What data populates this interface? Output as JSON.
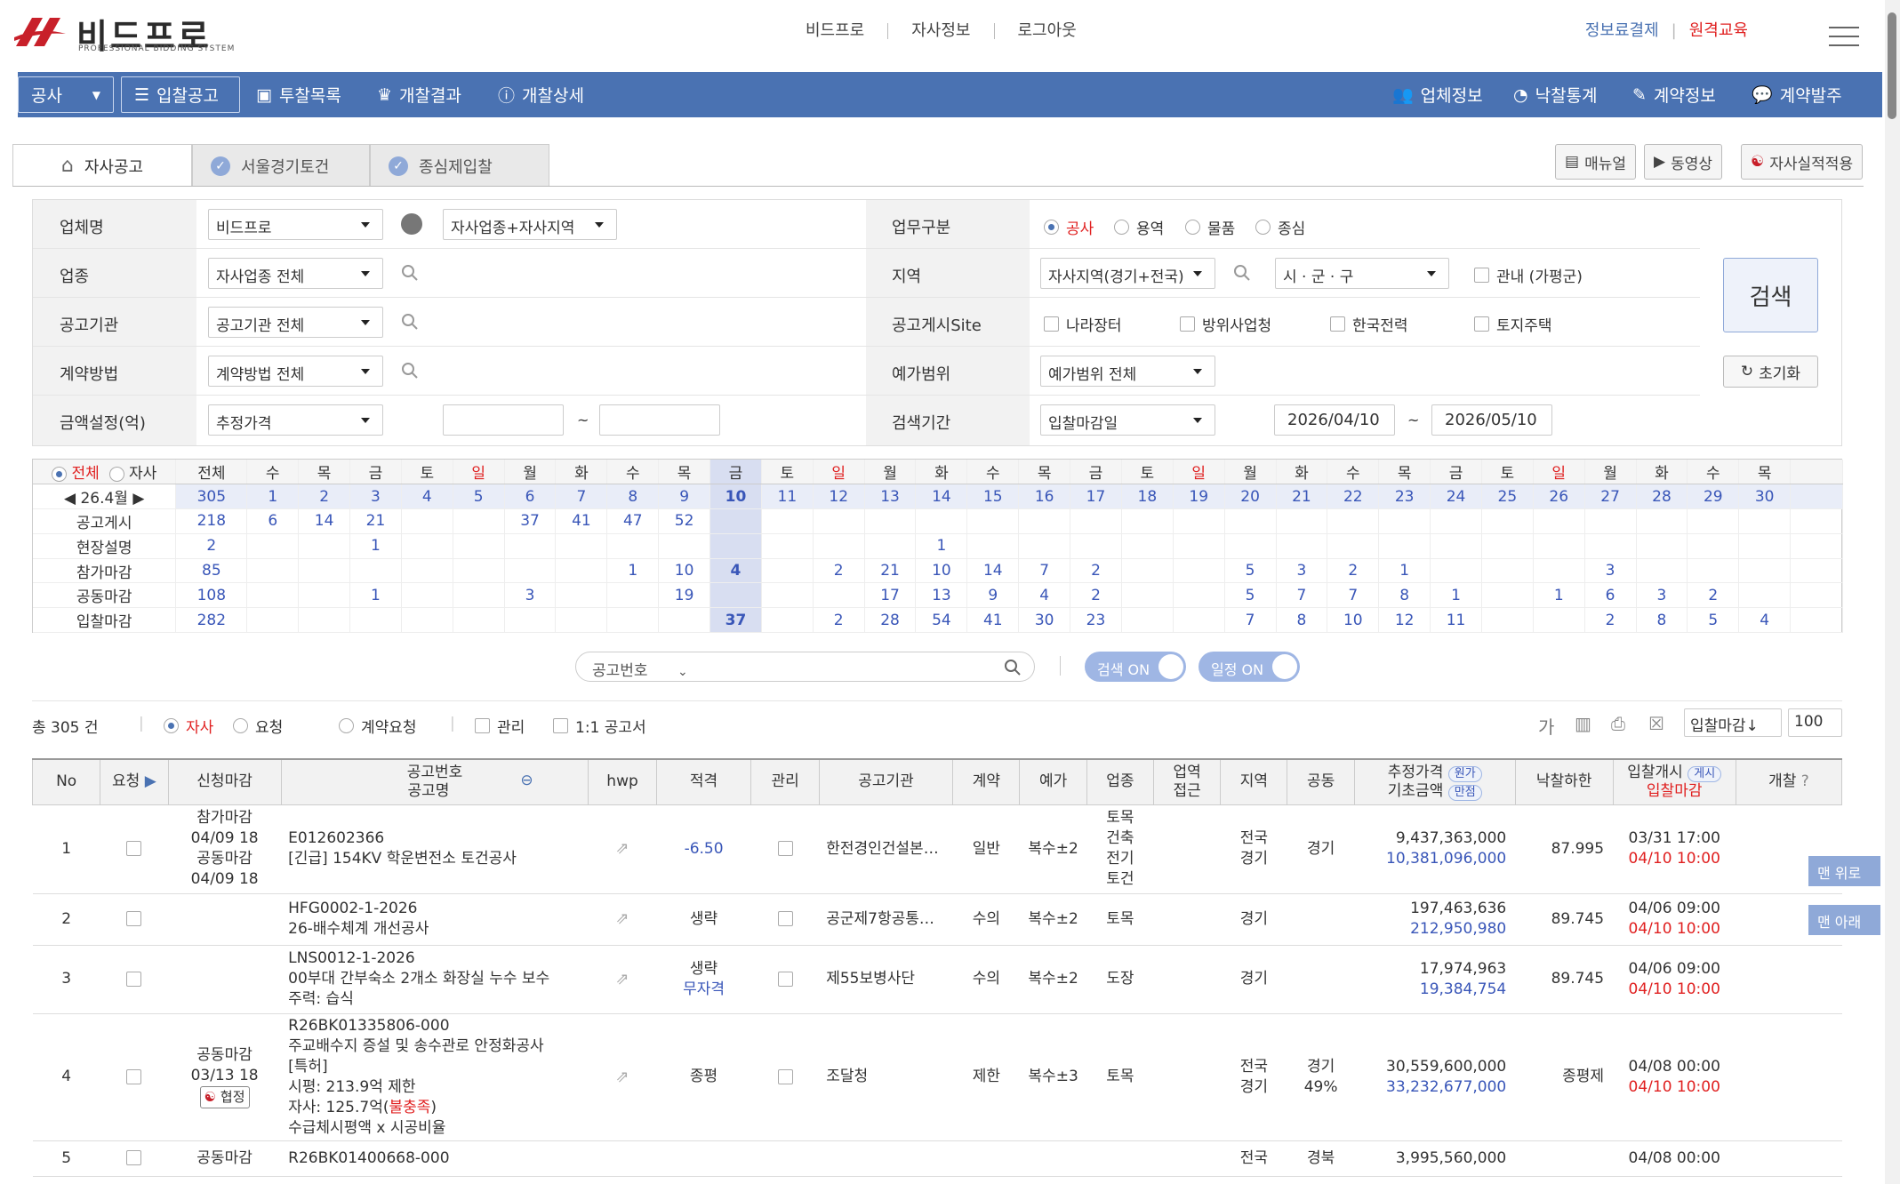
{
  "header": {
    "logo_text": "비드프로",
    "logo_sub": "PROFESSIONAL BIDDING SYSTEM",
    "nav": [
      "비드프로",
      "자사정보",
      "로그아웃"
    ],
    "right_links": [
      "정보료결제",
      "원격교육"
    ],
    "colors": {
      "brand": "#4a72b2",
      "accent_red": "#e02020",
      "link_blue": "#3956b8"
    }
  },
  "navbar": {
    "dropdown": "공사",
    "left": [
      "입찰공고",
      "투찰목록",
      "개찰결과",
      "개찰상세"
    ],
    "right": [
      "업체정보",
      "낙찰통계",
      "계약정보",
      "계약발주"
    ]
  },
  "tabs": [
    "자사공고",
    "서울경기토건",
    "종심제입찰"
  ],
  "tools": [
    "매뉴얼",
    "동영상",
    "자사실적적용"
  ],
  "form": {
    "labels": {
      "company": "업체명",
      "industry": "업종",
      "agency": "공고기관",
      "contract": "계약방법",
      "amount": "금액설정(억)",
      "biztype": "업무구분",
      "region": "지역",
      "site": "공고게시Site",
      "price_range": "예가범위",
      "period": "검색기간"
    },
    "company": "비드프로",
    "company_scope": "자사업종+자사지역",
    "industry": "자사업종 전체",
    "agency": "공고기관 전체",
    "contract": "계약방법 전체",
    "amount": "추정가격",
    "amount_sep": "~",
    "biztypes": [
      "공사",
      "용역",
      "물품",
      "종심"
    ],
    "region": "자사지역(경기+전국)",
    "city": "시 · 군 · 구",
    "region_opt": "관내 (가평군)",
    "sites": [
      "나라장터",
      "방위사업청",
      "한국전력",
      "토지주택"
    ],
    "price_range": "예가범위 전체",
    "period_type": "입찰마감일",
    "date_from": "2026/04/10",
    "date_sep": "~",
    "date_to": "2026/05/10",
    "search": "검색",
    "reset": "초기화"
  },
  "calendar": {
    "mode": [
      "전체",
      "자사"
    ],
    "month": "26.4월",
    "total_label": "전체",
    "weekdays": [
      "수",
      "목",
      "금",
      "토",
      "일",
      "월",
      "화",
      "수",
      "목",
      "금",
      "토",
      "일",
      "월",
      "화",
      "수",
      "목",
      "금",
      "토",
      "일",
      "월",
      "화",
      "수",
      "목",
      "금",
      "토",
      "일",
      "월",
      "화",
      "수",
      "목"
    ],
    "days": [
      "1",
      "2",
      "3",
      "4",
      "5",
      "6",
      "7",
      "8",
      "9",
      "10",
      "11",
      "12",
      "13",
      "14",
      "15",
      "16",
      "17",
      "18",
      "19",
      "20",
      "21",
      "22",
      "23",
      "24",
      "25",
      "26",
      "27",
      "28",
      "29",
      "30"
    ],
    "total": "305",
    "rows": [
      {
        "label": "공고게시",
        "total": "218",
        "vals": [
          "6",
          "14",
          "21",
          "",
          "",
          "37",
          "41",
          "47",
          "52",
          "",
          "",
          "",
          "",
          "",
          "",
          "",
          "",
          "",
          "",
          "",
          "",
          "",
          "",
          "",
          "",
          "",
          "",
          "",
          "",
          ""
        ]
      },
      {
        "label": "현장설명",
        "total": "2",
        "vals": [
          "",
          "",
          "1",
          "",
          "",
          "",
          "",
          "",
          "",
          "",
          "",
          "",
          "",
          "1",
          "",
          "",
          "",
          "",
          "",
          "",
          "",
          "",
          "",
          "",
          "",
          "",
          "",
          "",
          "",
          ""
        ]
      },
      {
        "label": "참가마감",
        "total": "85",
        "vals": [
          "",
          "",
          "",
          "",
          "",
          "",
          "",
          "1",
          "10",
          "4",
          "",
          "2",
          "21",
          "10",
          "14",
          "7",
          "2",
          "",
          "",
          "5",
          "3",
          "2",
          "1",
          "",
          "",
          "",
          "3",
          "",
          "",
          ""
        ]
      },
      {
        "label": "공동마감",
        "total": "108",
        "vals": [
          "",
          "",
          "1",
          "",
          "",
          "3",
          "",
          "",
          "19",
          "",
          "",
          "",
          "17",
          "13",
          "9",
          "4",
          "2",
          "",
          "",
          "5",
          "7",
          "7",
          "8",
          "1",
          "",
          "1",
          "6",
          "3",
          "2",
          ""
        ]
      },
      {
        "label": "입찰마감",
        "total": "282",
        "vals": [
          "",
          "",
          "",
          "",
          "",
          "",
          "",
          "",
          "",
          "37",
          "",
          "2",
          "28",
          "54",
          "41",
          "30",
          "23",
          "",
          "",
          "7",
          "8",
          "10",
          "12",
          "11",
          "",
          "",
          "2",
          "8",
          "5",
          "4"
        ]
      }
    ]
  },
  "search": {
    "type": "공고번호",
    "toggle1": "검색 ON",
    "toggle2": "일정 ON"
  },
  "filters": {
    "count": "총 305 건",
    "radios": [
      "자사",
      "요청",
      "계약요청"
    ],
    "checks": [
      "관리",
      "1:1 공고서"
    ],
    "font_btn": "가",
    "sort": "입찰마감↓",
    "page_size": "100"
  },
  "table": {
    "headers": {
      "no": "No",
      "req": "요청",
      "apply": "신청마감",
      "num1": "공고번호",
      "num2": "공고명",
      "hwp": "hwp",
      "qual": "적격",
      "mgmt": "관리",
      "agency": "공고기관",
      "contract": "계약",
      "price": "예가",
      "industry": "업종",
      "access1": "업역",
      "access2": "접근",
      "region": "지역",
      "joint": "공동",
      "est1": "추정가격",
      "est2": "기초금액",
      "pill1": "원가",
      "pill2": "만점",
      "rate": "낙찰하한",
      "open1": "입찰개시",
      "open2": "입찰마감",
      "pill3": "게시",
      "result": "개찰"
    },
    "rows": [
      {
        "no": "1",
        "apply": [
          "참가마감",
          "04/09 18",
          "공동마감",
          "04/09 18"
        ],
        "num": "E012602366",
        "name": [
          "[긴급] 154KV 학운변전소 토건공사"
        ],
        "qual": "-6.50",
        "qual2": "",
        "agency": "한전경인건설본…",
        "contract": "일반",
        "price": "복수±2",
        "industry": [
          "토목",
          "건축",
          "전기",
          "토건"
        ],
        "region": [
          "전국",
          "경기"
        ],
        "joint": [
          "경기"
        ],
        "est": "9,437,363,000",
        "base": "10,381,096,000",
        "rate": "87.995",
        "open": "03/31 17:00",
        "close": "04/10 10:00"
      },
      {
        "no": "2",
        "apply": [],
        "num": "HFG0002-1-2026",
        "name": [
          "26-배수체계 개선공사"
        ],
        "qual": "생략",
        "qual2": "",
        "agency": "공군제7항공통…",
        "contract": "수의",
        "price": "복수±2",
        "industry": [
          "토목"
        ],
        "region": [
          "경기"
        ],
        "joint": [],
        "est": "197,463,636",
        "base": "212,950,980",
        "rate": "89.745",
        "open": "04/06 09:00",
        "close": "04/10 10:00"
      },
      {
        "no": "3",
        "apply": [],
        "num": "LNS0012-1-2026",
        "name": [
          "00부대 간부숙소 2개소 화장실 누수 보수",
          "주력: 습식"
        ],
        "qual": "생략",
        "qual2": "무자격",
        "agency": "제55보병사단",
        "contract": "수의",
        "price": "복수±2",
        "industry": [
          "도장"
        ],
        "region": [
          "경기"
        ],
        "joint": [],
        "est": "17,974,963",
        "base": "19,384,754",
        "rate": "89.745",
        "open": "04/06 09:00",
        "close": "04/10 10:00"
      },
      {
        "no": "4",
        "apply": [
          "공동마감",
          "03/13 18"
        ],
        "badge": "협정",
        "num": "R26BK01335806-000",
        "name": [
          "주교배수지 증설 및 송수관로 안정화공사",
          "[특허]",
          "시평: 213.9억 제한"
        ],
        "name_self": "자사: 125.7억(",
        "name_short": "불충족",
        "name_close": ")",
        "name_last": "수급체시평액 x 시공비율",
        "qual": "종평",
        "qual2": "",
        "agency": "조달청",
        "contract": "제한",
        "price": "복수±3",
        "industry": [
          "토목"
        ],
        "region": [
          "전국",
          "경기"
        ],
        "joint": [
          "경기",
          "49%"
        ],
        "est": "30,559,600,000",
        "base": "33,232,677,000",
        "rate": "종평제",
        "open": "04/08 00:00",
        "close": "04/10 10:00"
      },
      {
        "no": "5",
        "apply": [
          "공동마감"
        ],
        "num": "R26BK01400668-000",
        "name": [
          ""
        ],
        "qual": "",
        "qual2": "",
        "agency": "",
        "contract": "",
        "price": "",
        "industry": [],
        "region": [
          "전국"
        ],
        "joint": [
          "경북"
        ],
        "est": "3,995,560,000",
        "base": "",
        "rate": "",
        "open": "04/08 00:00",
        "close": ""
      }
    ]
  },
  "side": {
    "top": "맨 위로",
    "bottom": "맨 아래"
  }
}
